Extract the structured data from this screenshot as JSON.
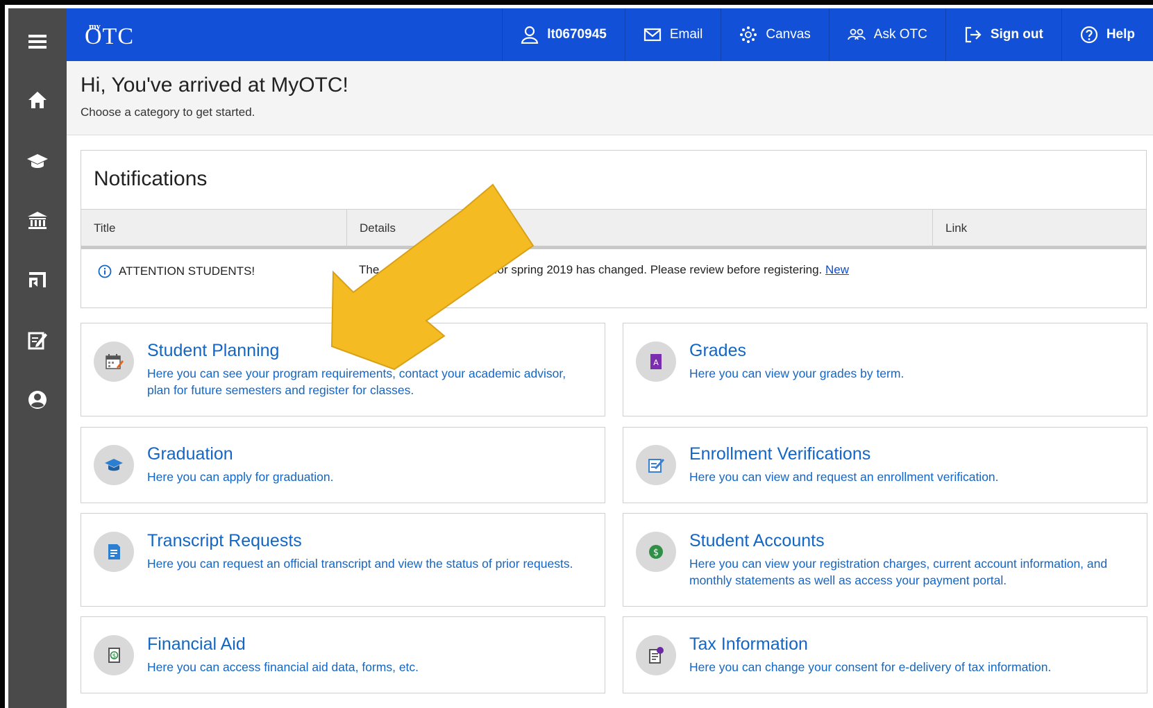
{
  "topbar": {
    "logo_my": "my",
    "logo_otc": "OTC",
    "nav": [
      {
        "label": "lt0670945",
        "icon": "user-icon"
      },
      {
        "label": "Email",
        "icon": "envelope-icon"
      },
      {
        "label": "Canvas",
        "icon": "canvas-icon"
      },
      {
        "label": "Ask OTC",
        "icon": "people-icon"
      },
      {
        "label": "Sign out",
        "icon": "sign-out-icon"
      },
      {
        "label": "Help",
        "icon": "help-icon"
      }
    ]
  },
  "sidebar": [
    "menu-icon",
    "home-icon",
    "graduation-cap-icon",
    "bank-icon",
    "flag-icon",
    "edit-icon",
    "profile-icon"
  ],
  "welcome": {
    "title": "Hi, You've arrived at MyOTC!",
    "subtitle": "Choose a category to get started."
  },
  "notifications": {
    "heading": "Notifications",
    "columns": [
      "Title",
      "Details",
      "Link"
    ],
    "rows": [
      {
        "title": "ATTENTION STUDENTS!",
        "details_prefix": "The",
        "details_mid": "for spring 2019 has changed. Please review before registering.",
        "link": "New"
      }
    ]
  },
  "cards": [
    {
      "title": "Student Planning",
      "desc": "Here you can see your program requirements, contact your academic advisor, plan for future semesters and register for classes.",
      "icon": "calendar-icon"
    },
    {
      "title": "Grades",
      "desc": "Here you can view your grades by term.",
      "icon": "grade-icon"
    },
    {
      "title": "Graduation",
      "desc": "Here you can apply for graduation.",
      "icon": "graduation-icon"
    },
    {
      "title": "Enrollment Verifications",
      "desc": "Here you can view and request an enrollment verification.",
      "icon": "verify-icon"
    },
    {
      "title": "Transcript Requests",
      "desc": "Here you can request an official transcript and view the status of prior requests.",
      "icon": "transcript-icon"
    },
    {
      "title": "Student Accounts",
      "desc": "Here you can view your registration charges, current account information, and monthly statements as well as access your payment portal.",
      "icon": "dollar-icon"
    },
    {
      "title": "Financial Aid",
      "desc": "Here you can access financial aid data, forms, etc.",
      "icon": "money-icon"
    },
    {
      "title": "Tax Information",
      "desc": "Here you can change your consent for e-delivery of tax information.",
      "icon": "tax-form-icon"
    }
  ],
  "colors": {
    "topbar": "#1350d8",
    "sidebar": "#4a4a4a",
    "link": "#1466c4",
    "arrow": "#f4bc22"
  }
}
